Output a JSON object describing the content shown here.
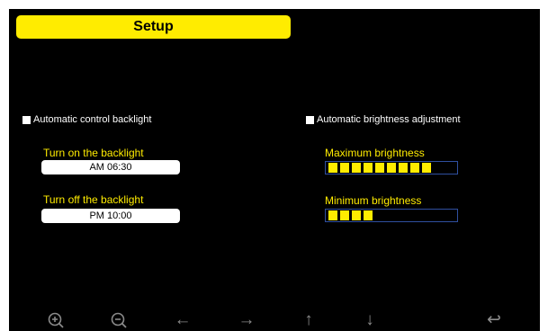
{
  "header": {
    "title": "Setup"
  },
  "backlight": {
    "auto_label": "Automatic control backlight",
    "on_label": "Turn on the backlight",
    "on_time": "AM 06:30",
    "off_label": "Turn off the backlight",
    "off_time": "PM 10:00"
  },
  "brightness": {
    "auto_label": "Automatic brightness adjustment",
    "max_label": "Maximum brightness",
    "max_level": 9,
    "min_label": "Minimum brightness",
    "min_level": 4,
    "level_max": 10
  },
  "toolbar": {
    "icons": [
      "zoom-in-icon",
      "zoom-out-icon",
      "arrow-left-icon",
      "arrow-right-icon",
      "arrow-up-icon",
      "arrow-down-icon",
      "return-icon"
    ]
  },
  "colors": {
    "accent": "#ffec00",
    "background": "#000000",
    "bar_border": "#2f4f9f",
    "icon": "#8a8a8a"
  }
}
